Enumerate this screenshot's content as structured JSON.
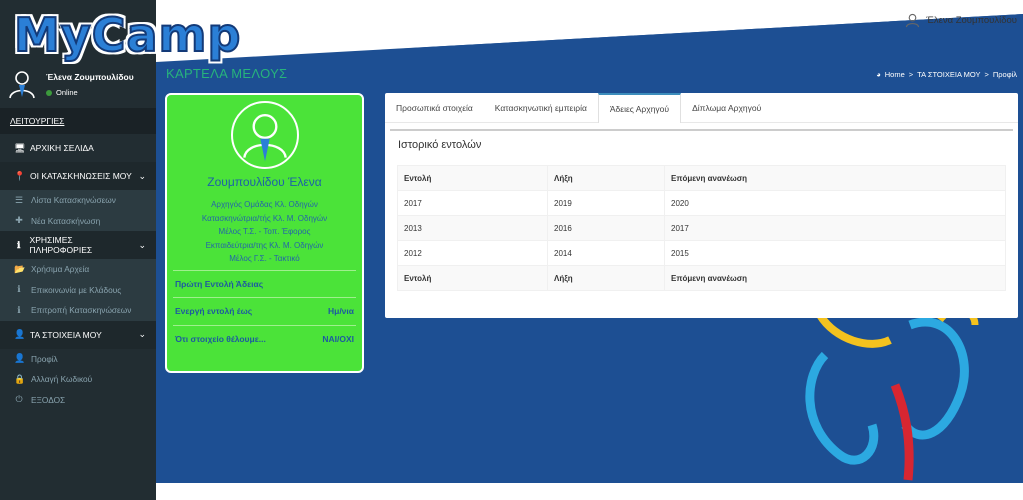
{
  "app": {
    "logo": "MyCamp"
  },
  "header": {
    "user_name": "Έλενα Ζουμπουλίδου"
  },
  "sidebar": {
    "user_name": "Έλενα Ζουμπουλίδου",
    "status": "Online",
    "nav_header": "ΛΕΙΤΟΥΡΓΙΕΣ",
    "home": "ΑΡΧΙΚΗ ΣΕΛΙΔΑ",
    "sections": [
      {
        "label": "ΟΙ ΚΑΤΑΣΚΗΝΩΣΕΙΣ ΜΟΥ",
        "icon": "map-marker-icon",
        "items": [
          {
            "label": "Λίστα Κατασκηνώσεων",
            "icon": "list-icon"
          },
          {
            "label": "Νέα Κατασκήνωση",
            "icon": "plus-icon"
          }
        ]
      },
      {
        "label": "ΧΡΗΣΙΜΕΣ ΠΛΗΡΟΦΟΡΙΕΣ",
        "icon": "info-icon",
        "items": [
          {
            "label": "Χρήσιμα Αρχεία",
            "icon": "folder-icon"
          },
          {
            "label": "Επικοινωνία με Κλάδους",
            "icon": "info-icon"
          },
          {
            "label": "Επιτροπή Κατασκηνώσεων",
            "icon": "info-icon"
          }
        ]
      },
      {
        "label": "ΤΑ ΣΤΟΙΧΕΙΑ ΜΟΥ",
        "icon": "user-icon",
        "items": [
          {
            "label": "Προφίλ",
            "icon": "user-icon"
          },
          {
            "label": "Αλλαγή Κωδικού",
            "icon": "lock-icon"
          },
          {
            "label": "ΕΞΟΔΟΣ",
            "icon": "power-icon"
          }
        ]
      }
    ]
  },
  "page": {
    "title": "ΚΑΡΤΕΛΑ ΜΕΛΟΥΣ",
    "breadcrumb": [
      "Home",
      "ΤΑ ΣΤΟΙΧΕΙΑ ΜΟΥ",
      "Προφίλ"
    ]
  },
  "profile": {
    "name": "Ζουμπουλίδου Έλενα",
    "roles": [
      "Αρχηγός Ομάδας Κλ. Οδηγών",
      "Κατασκηνώτρια/τής Κλ. Μ. Οδηγών",
      "Μέλος Τ.Σ. - Τοπ. Έφορος",
      "Εκπαιδεύτρια/της Κλ. Μ. Οδηγών",
      "Μέλος Γ.Σ. - Τακτικό"
    ],
    "rows": [
      {
        "label": "Πρώτη Εντολή Άδειας",
        "value": ""
      },
      {
        "label": "Ενεργή εντολή έως",
        "value": "Ημ/νια"
      },
      {
        "label": "Ότι στοιχείο θέλουμε...",
        "value": "ΝΑΙ/ΟΧΙ"
      }
    ]
  },
  "tabs": [
    "Προσωπικά στοιχεία",
    "Κατασκηνωτική εμπειρία",
    "Άδειες Αρχηγού",
    "Δίπλωμα Αρχηγού"
  ],
  "history": {
    "title": "Ιστορικό εντολών",
    "columns": [
      "Εντολή",
      "Λήξη",
      "Επόμενη ανανέωση"
    ],
    "rows": [
      [
        "2017",
        "2019",
        "2020"
      ],
      [
        "2013",
        "2016",
        "2017"
      ],
      [
        "2012",
        "2014",
        "2015"
      ]
    ]
  },
  "colors": {
    "sidebar": "#222d32",
    "content_bg": "#1d4f93",
    "card": "#4be339",
    "accent": "#3c8dbc"
  }
}
